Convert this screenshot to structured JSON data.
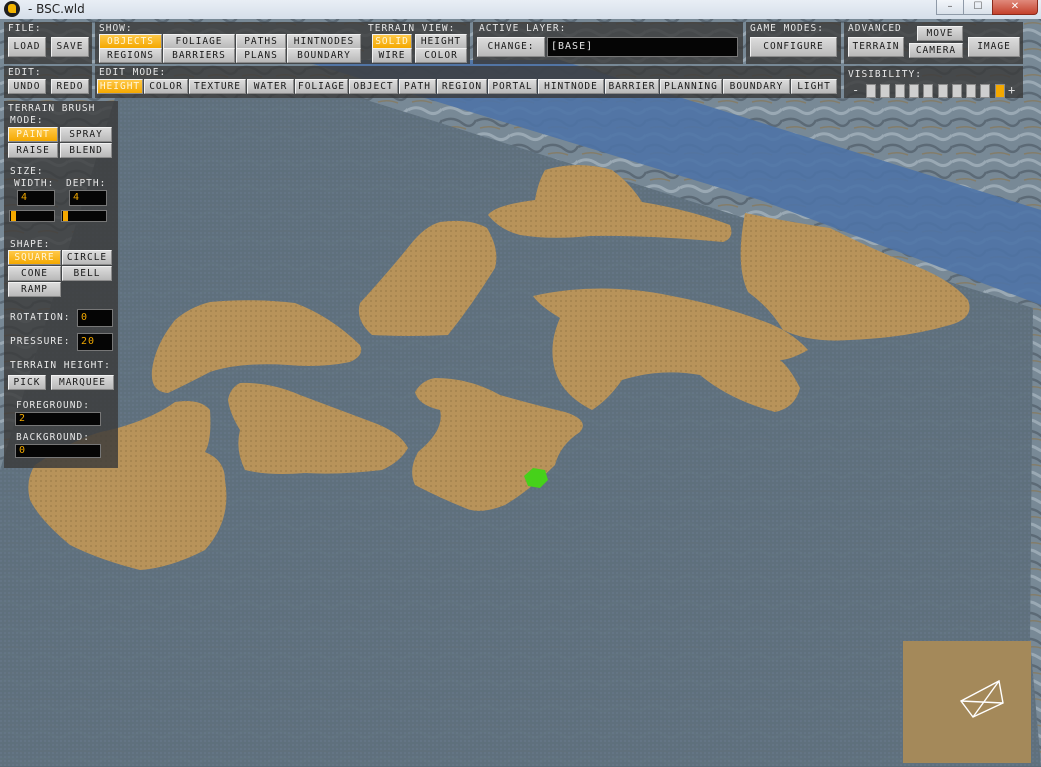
{
  "window": {
    "title": "- BSC.wld",
    "min": "–",
    "max": "☐",
    "close": "✕"
  },
  "toolbar": {
    "file": {
      "label": "FILE:",
      "load": "LOAD",
      "save": "SAVE"
    },
    "show": {
      "label": "SHOW:",
      "items": [
        "OBJECTS",
        "FOLIAGE",
        "PATHS",
        "HINTNODES",
        "REGIONS",
        "BARRIERS",
        "PLANS",
        "BOUNDARY"
      ],
      "active": "OBJECTS"
    },
    "terrain_view": {
      "label": "TERRAIN VIEW:",
      "items": [
        "SOLID",
        "HEIGHT",
        "WIRE",
        "COLOR"
      ],
      "active": "SOLID"
    },
    "active_layer": {
      "label": "ACTIVE LAYER:",
      "change": "CHANGE:",
      "value": "[BASE]"
    },
    "game_modes": {
      "label": "GAME MODES:",
      "configure": "CONFIGURE"
    },
    "advanced": {
      "label": "ADVANCED",
      "move": "MOVE",
      "terrain": "TERRAIN",
      "camera": "CAMERA",
      "image": "IMAGE"
    },
    "edit": {
      "label": "EDIT:",
      "undo": "UNDO",
      "redo": "REDO"
    },
    "edit_mode": {
      "label": "EDIT MODE:",
      "items": [
        "HEIGHT",
        "COLOR",
        "TEXTURE",
        "WATER",
        "FOLIAGE",
        "OBJECT",
        "PATH",
        "REGION",
        "PORTAL",
        "HINTNODE",
        "BARRIER",
        "PLANNING",
        "BOUNDARY",
        "LIGHT"
      ],
      "active": "HEIGHT"
    },
    "visibility": {
      "label": "VISIBILITY:",
      "minus": "-",
      "plus": "+",
      "level": 9,
      "steps": 10
    }
  },
  "brush": {
    "title": "TERRAIN BRUSH",
    "mode_label": "MODE:",
    "modes": [
      "PAINT",
      "SPRAY",
      "RAISE",
      "BLEND"
    ],
    "active_mode": "PAINT",
    "size_label": "SIZE:",
    "width_label": "WIDTH:",
    "depth_label": "DEPTH:",
    "width": "4",
    "depth": "4",
    "shape_label": "SHAPE:",
    "shapes": [
      "SQUARE",
      "CIRCLE",
      "CONE",
      "BELL",
      "RAMP"
    ],
    "active_shape": "SQUARE",
    "rotation_label": "ROTATION:",
    "rotation": "0",
    "pressure_label": "PRESSURE:",
    "pressure": "20",
    "height_label": "TERRAIN HEIGHT:",
    "pick": "PICK",
    "marquee": "MARQUEE",
    "foreground_label": "FOREGROUND:",
    "foreground": "2",
    "background_label": "BACKGROUND:",
    "background": "0"
  },
  "colors": {
    "panel": "#3a3a3a",
    "accent": "#f4a800",
    "terrain_sand": "#b8935a",
    "water": "#5e6f7c"
  },
  "icons": {
    "app": "app-logo-icon",
    "camera_gizmo": "camera-frustum-icon"
  }
}
